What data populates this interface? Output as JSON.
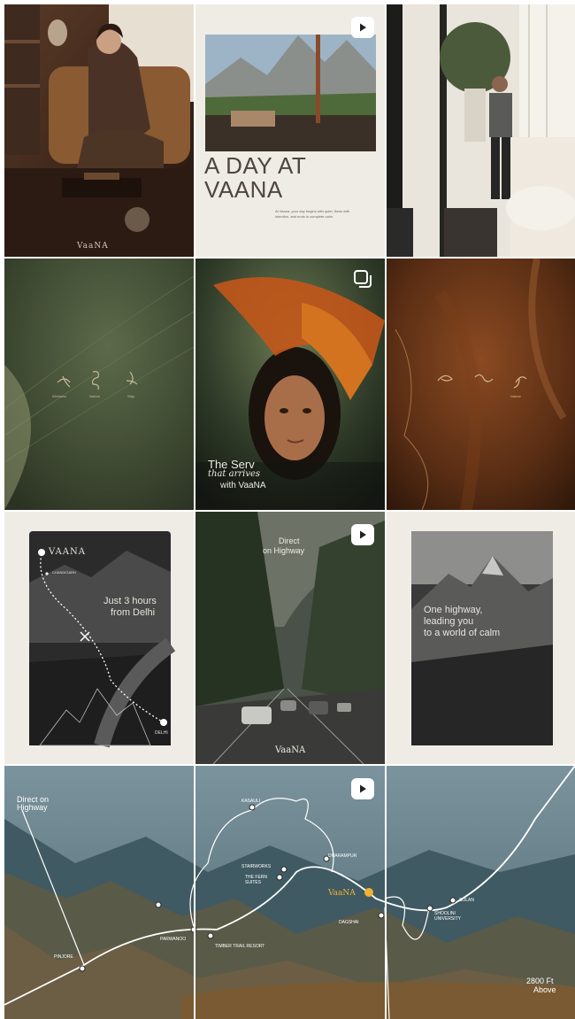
{
  "posts": {
    "p1": {
      "logo": "VaaNA"
    },
    "p2": {
      "title_line1": "A DAY AT",
      "title_line2": "VAANA",
      "body": "At Vaana, your day begins with quiet, flows with intention, and ends in complete calm."
    },
    "p4": {
      "labels": [
        "Wellness",
        "Nature",
        "Stay"
      ]
    },
    "p5": {
      "line1": "The Serv",
      "line2": "that arrives",
      "line3": "with VaaNA"
    },
    "p6": {
      "labels": [
        "",
        "",
        "Nature"
      ]
    },
    "p7": {
      "brand": "VAANA",
      "stop": "CHANDIGARH",
      "headline_line1": "Just 3 hours",
      "headline_line2": "from Delhi",
      "destination": "DELHI"
    },
    "p8": {
      "line1": "Direct",
      "line2": "on Highway",
      "logo": "VaaNA"
    },
    "p9": {
      "line1": "One highway,",
      "line2": "leading you",
      "line3": "to a world of calm"
    },
    "map": {
      "title_line1": "Direct on",
      "title_line2": "Highway",
      "places": {
        "kasauli": "KASAULI",
        "dharampur": "DHARAMPUR",
        "stairworks": "STAIRWORKS",
        "the_fern_suites": "THE FERN SUITES",
        "vaana": "VaaNA",
        "dagshai": "DAGSHAI",
        "solan": "SOLAN",
        "shoolini": "SHOOLINI UNIVERSITY",
        "kasauli_hills": "",
        "parwanoo": "PARWANOO",
        "pinjore": "PINJORE",
        "timber_trail": "TIMBER TRAIL RESORT"
      },
      "elevation_line1": "2800 Ft",
      "elevation_line2": "Above"
    }
  },
  "icons": {
    "video": "play-icon",
    "carousel": "multiple-images-icon"
  }
}
